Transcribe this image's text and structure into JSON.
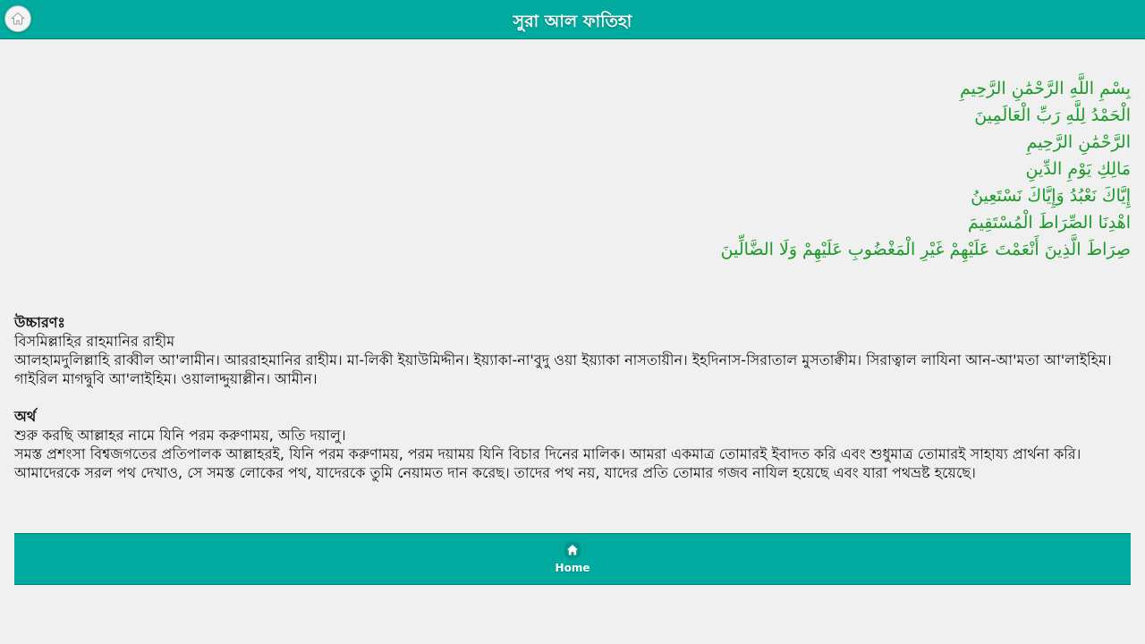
{
  "header": {
    "title": "সুরা আল ফাতিহা"
  },
  "arabic": {
    "ayahs": [
      "بِسْمِ اللَّهِ الرَّحْمَٰنِ الرَّحِيمِ",
      "الْحَمْدُ لِلَّهِ رَبِّ الْعَالَمِينَ",
      "الرَّحْمَٰنِ الرَّحِيمِ",
      "مَالِكِ يَوْمِ الدِّينِ",
      "إِيَّاكَ نَعْبُدُ وَإِيَّاكَ نَسْتَعِينُ",
      "اهْدِنَا الصِّرَاطَ الْمُسْتَقِيمَ",
      "صِرَاطَ الَّذِينَ أَنْعَمْتَ عَلَيْهِمْ غَيْرِ الْمَغْضُوبِ عَلَيْهِمْ وَلَا الضَّالِّينَ"
    ],
    "color": "#1a9a2a"
  },
  "pronunciation": {
    "heading": "উচ্চারণঃ",
    "line1": "বিসমিল্লাহির রাহমানির রাহীম",
    "line2": "আলহামদুলিল্লাহি রাব্বীল আ'লামীন। আররাহমানির রাহীম। মা-লিকী ইয়াউমিদ্দীন। ইয়্যাকা-না'বুদু ওয়া ইয়্যাকা নাসতায়ীন। ইহদিনাস-সিরাতাল মুসতাক্বীম। সিরাত্বাল লাযিনা আন-আ'মতা আ'লাইহিম।গাইরিল মাগদ্বুবি আ'লাইহিম। ওয়ালাদ্দুয়াল্লীন। আমীন।"
  },
  "meaning": {
    "heading": "অর্থ",
    "line1": "শুরু করছি আল্লাহর নামে যিনি পরম করুণাময়, অতি দয়ালু।",
    "line2": "সমস্ত প্রশংসা বিশ্বজগতের প্রতিপালক আল্লাহরই, যিনি পরম করুণাময়, পরম দয়াময় যিনি বিচার দিনের মালিক। আমরা একমাত্র তোমারই ইবাদত করি এবং শুধুমাত্র তোমারই সাহায্য প্রার্থনা করি। আমাদেরকে সরল পথ দেখাও, সে সমস্ত লোকের পথ, যাদেরকে তুমি নেয়ামত দান করেছ। তাদের পথ নয়, যাদের প্রতি তোমার গজব নাযিল হয়েছে এবং যারা পথভ্রষ্ট হয়েছে।"
  },
  "footer": {
    "home_label": "Home",
    "icon": "home-icon"
  },
  "colors": {
    "bar": "#00aa9e",
    "background": "#f0f0f0"
  }
}
